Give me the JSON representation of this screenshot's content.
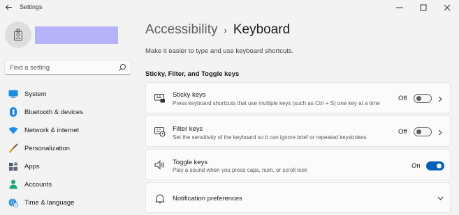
{
  "window": {
    "title": "Settings",
    "back_icon": "back-arrow-icon",
    "controls": [
      "minimize-icon",
      "maximize-icon",
      "close-icon"
    ]
  },
  "user": {
    "avatar_icon": "user-badge-icon",
    "name_redacted_color": "#b6b3f9"
  },
  "search": {
    "placeholder": "Find a setting",
    "icon": "search-icon"
  },
  "sidebar": {
    "items": [
      {
        "label": "System",
        "icon": "system-monitor-icon"
      },
      {
        "label": "Bluetooth & devices",
        "icon": "bluetooth-icon"
      },
      {
        "label": "Network & internet",
        "icon": "wifi-icon"
      },
      {
        "label": "Personalization",
        "icon": "paintbrush-icon"
      },
      {
        "label": "Apps",
        "icon": "apps-icon"
      },
      {
        "label": "Accounts",
        "icon": "accounts-icon"
      },
      {
        "label": "Time & language",
        "icon": "globe-clock-icon"
      }
    ]
  },
  "breadcrumb": {
    "parent": "Accessibility",
    "separator": "›",
    "current": "Keyboard"
  },
  "page": {
    "description": "Make it easier to type and use keyboard shortcuts.",
    "section_title": "Sticky, Filter, and Toggle keys"
  },
  "settings": {
    "sticky_keys": {
      "title": "Sticky keys",
      "description": "Press keyboard shortcuts that use multiple keys (such as Ctrl + S) one key at a time",
      "state": "Off",
      "icon": "sticky-keys-icon"
    },
    "filter_keys": {
      "title": "Filter keys",
      "description": "Set the sensitivity of the keyboard so it can ignore brief or repeated keystrokes",
      "state": "Off",
      "icon": "filter-keys-icon"
    },
    "toggle_keys": {
      "title": "Toggle keys",
      "description": "Play a sound when you press caps, num, or scroll lock",
      "state": "On",
      "icon": "speaker-icon"
    },
    "notification_preferences": {
      "title": "Notification preferences",
      "icon": "bell-icon"
    }
  },
  "colors": {
    "accent": "#005fb8",
    "background": "#f3f3f3",
    "card": "#fbfbfb"
  }
}
